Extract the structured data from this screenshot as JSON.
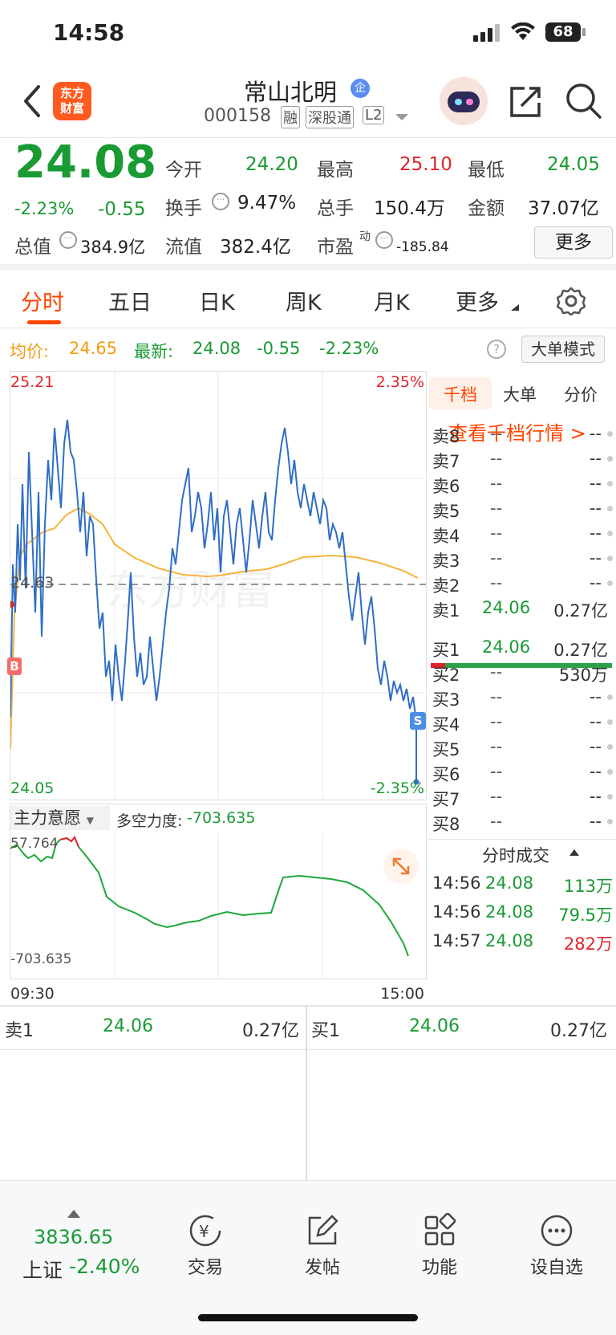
{
  "status": {
    "time": "14:58",
    "battery": "68"
  },
  "nav": {
    "logo": "东方\n财富",
    "title": "常山北明",
    "badge": "企",
    "code": "000158",
    "tag1": "融",
    "tag2": "深股通",
    "tag3": "L2"
  },
  "quote": {
    "price": "24.08",
    "pct": "-2.23%",
    "chg": "-0.55",
    "open_label": "今开",
    "open": "24.20",
    "high_label": "最高",
    "high": "25.10",
    "low_label": "最低",
    "low": "24.05",
    "turn_label": "换手",
    "turn": "9.47%",
    "vol_label": "总手",
    "vol": "150.4万",
    "amt_label": "金额",
    "amt": "37.07亿",
    "mcap_label": "总值",
    "mcap": "384.9亿",
    "fcap_label": "流值",
    "fcap": "382.4亿",
    "pe_label": "市盈",
    "pe_sup": "动",
    "pe": "-185.84",
    "more": "更多"
  },
  "tabs": [
    "分时",
    "五日",
    "日K",
    "周K",
    "月K",
    "更多"
  ],
  "info": {
    "avg_label": "均价:",
    "avg": "24.65",
    "last_label": "最新:",
    "last": "24.08",
    "chg": "-0.55",
    "pct": "-2.23%",
    "mode": "大单模式"
  },
  "chart_data": {
    "type": "line",
    "ylim": [
      24.05,
      25.21
    ],
    "y_max_label": "25.21",
    "y_min_label": "24.05",
    "pct_max_label": "2.35%",
    "pct_min_label": "-2.35%",
    "ref_label": "24.63",
    "x_start": "09:30",
    "x_end": "15:00",
    "buy_marker": "B",
    "sell_marker": "S",
    "watermark": "东方财富"
  },
  "sub": {
    "indicator": "主力意愿",
    "strength_label": "多空力度:",
    "strength": "-703.635",
    "top": "57.764",
    "bottom": "-703.635"
  },
  "side": {
    "tabs": [
      "千档",
      "大单",
      "分价"
    ],
    "link": "查看千档行情 >",
    "asks": [
      {
        "l": "卖8",
        "p": "--",
        "v": "--"
      },
      {
        "l": "卖7",
        "p": "--",
        "v": "--"
      },
      {
        "l": "卖6",
        "p": "--",
        "v": "--"
      },
      {
        "l": "卖5",
        "p": "--",
        "v": "--"
      },
      {
        "l": "卖4",
        "p": "--",
        "v": "--"
      },
      {
        "l": "卖3",
        "p": "--",
        "v": "--"
      },
      {
        "l": "卖2",
        "p": "--",
        "v": "--"
      },
      {
        "l": "卖1",
        "p": "24.06",
        "v": "0.27亿"
      }
    ],
    "bids": [
      {
        "l": "买1",
        "p": "24.06",
        "v": "0.27亿"
      },
      {
        "l": "买2",
        "p": "--",
        "v": "530万"
      },
      {
        "l": "买3",
        "p": "--",
        "v": "--"
      },
      {
        "l": "买4",
        "p": "--",
        "v": "--"
      },
      {
        "l": "买5",
        "p": "--",
        "v": "--"
      },
      {
        "l": "买6",
        "p": "--",
        "v": "--"
      },
      {
        "l": "买7",
        "p": "--",
        "v": "--"
      },
      {
        "l": "买8",
        "p": "--",
        "v": "--"
      }
    ],
    "ticks_title": "分时成交",
    "ticks": [
      {
        "t": "14:56",
        "p": "24.08",
        "v": "113万"
      },
      {
        "t": "14:56",
        "p": "24.08",
        "v": "79.5万"
      },
      {
        "t": "14:57",
        "p": "24.08",
        "v": "282万"
      }
    ]
  },
  "bar": {
    "sell_label": "卖1",
    "sell_price": "24.06",
    "sell_vol": "0.27亿",
    "buy_label": "买1",
    "buy_price": "24.06",
    "buy_vol": "0.27亿"
  },
  "bottom": {
    "index_value": "3836.65",
    "index_name": "上证",
    "index_pct": "-2.40%",
    "trade": "交易",
    "post": "发帖",
    "func": "功能",
    "watch": "设自选"
  }
}
